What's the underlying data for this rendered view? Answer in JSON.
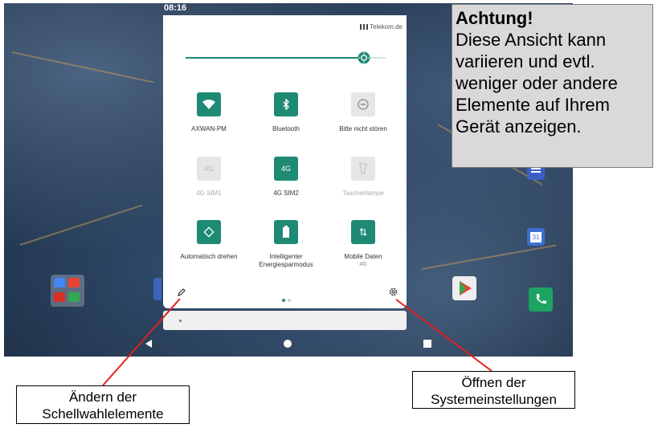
{
  "status_bar": {
    "time": "08:16",
    "carrier": "Telekom.de"
  },
  "brightness": {
    "level": 0.89
  },
  "tiles": [
    {
      "label": "AXWAN-PM",
      "icon": "wifi-icon",
      "active": true
    },
    {
      "label": "Bluetooth",
      "icon": "bluetooth-icon",
      "active": true
    },
    {
      "label": "Bitte nicht stören",
      "icon": "do-not-disturb-icon",
      "active": false
    },
    {
      "label": "4G SIM1",
      "icon": "4g-icon",
      "icon_text": "4G",
      "active": false
    },
    {
      "label": "4G SIM2",
      "icon": "4g-icon",
      "icon_text": "4G",
      "active": true
    },
    {
      "label": "Taschenlampe",
      "icon": "flashlight-icon",
      "active": false
    },
    {
      "label": "Automatisch drehen",
      "icon": "auto-rotate-icon",
      "active": true
    },
    {
      "label": "Intelligenter Energiesparmodus",
      "icon": "battery-icon",
      "active": true
    },
    {
      "label": "Mobile Daten",
      "sublabel": "4G",
      "icon": "mobile-data-icon",
      "active": true
    }
  ],
  "pager": {
    "pages": 2,
    "current": 1
  },
  "note": {
    "title": "Achtung!",
    "text": "Diese Ansicht kann variieren und evtl. weniger oder andere Elemente auf Ihrem Gerät anzeigen."
  },
  "callouts": {
    "edit": {
      "line1": "Ändern der",
      "line2": "Schellwahlelemente"
    },
    "settings": {
      "line1": "Öffnen der",
      "line2": "Systemeinstellungen"
    }
  },
  "colors": {
    "accent": "#1e8a74",
    "tile_off": "#e6e6e6",
    "note_bg": "#d9d9d9",
    "callout_line": "#e02020"
  }
}
